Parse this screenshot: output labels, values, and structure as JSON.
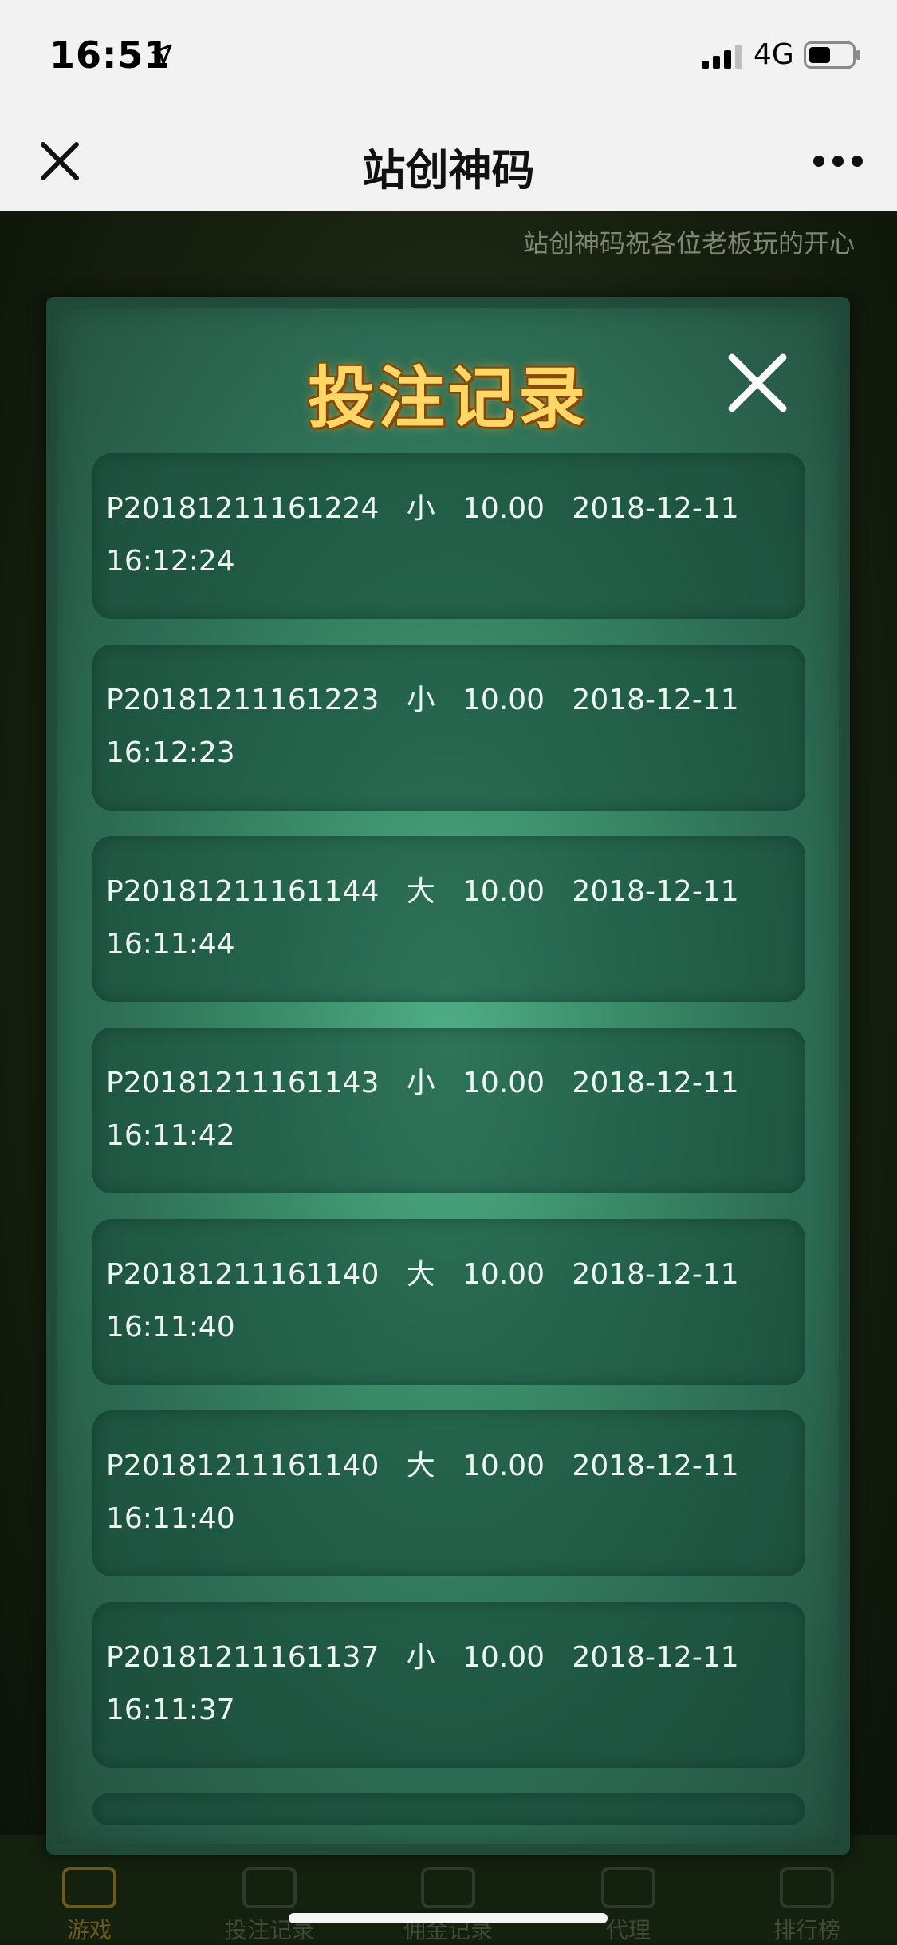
{
  "status_bar": {
    "time": "16:51",
    "network": "4G"
  },
  "nav": {
    "title": "站创神码"
  },
  "marquee": "站创神码祝各位老板玩的开心",
  "modal": {
    "title": "投注记录",
    "records": [
      {
        "id": "P20181211161224",
        "bet": "小",
        "amount": "10.00",
        "date": "2018-12-11",
        "time": "16:12:24"
      },
      {
        "id": "P20181211161223",
        "bet": "小",
        "amount": "10.00",
        "date": "2018-12-11",
        "time": "16:12:23"
      },
      {
        "id": "P20181211161144",
        "bet": "大",
        "amount": "10.00",
        "date": "2018-12-11",
        "time": "16:11:44"
      },
      {
        "id": "P20181211161143",
        "bet": "小",
        "amount": "10.00",
        "date": "2018-12-11",
        "time": "16:11:42"
      },
      {
        "id": "P20181211161140",
        "bet": "大",
        "amount": "10.00",
        "date": "2018-12-11",
        "time": "16:11:40"
      },
      {
        "id": "P20181211161140",
        "bet": "大",
        "amount": "10.00",
        "date": "2018-12-11",
        "time": "16:11:40"
      },
      {
        "id": "P20181211161137",
        "bet": "小",
        "amount": "10.00",
        "date": "2018-12-11",
        "time": "16:11:37"
      }
    ]
  },
  "bottom_tabs": [
    {
      "label": "游戏",
      "icon": "gamepad-icon"
    },
    {
      "label": "投注记录",
      "icon": "document-icon"
    },
    {
      "label": "佣金记录",
      "icon": "coin-icon"
    },
    {
      "label": "代理",
      "icon": "piggy-bank-icon"
    },
    {
      "label": "排行榜",
      "icon": "trophy-icon"
    }
  ],
  "colors": {
    "title_gold": "#ffd766",
    "panel_green": "#3b8c6a"
  }
}
